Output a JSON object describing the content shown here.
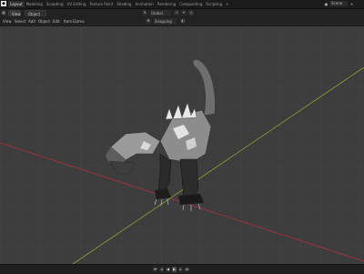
{
  "app": {
    "logo_label": ""
  },
  "workspace_tabs": [
    "Layout",
    "Modeling",
    "Sculpting",
    "UV Editing",
    "Texture Paint",
    "Shading",
    "Animation",
    "Rendering",
    "Compositing",
    "Scripting",
    "+"
  ],
  "active_tab_index": 0,
  "scene": {
    "field_label": "Scene",
    "view_layer_label": "View Layer"
  },
  "mode": {
    "object_mode_label": "Object Mode",
    "view_label": "View"
  },
  "header3": {
    "menu": [
      "View",
      "Select",
      "Add",
      "Object",
      "Edit",
      "Item",
      "Gizmo"
    ]
  },
  "transform": {
    "global_label": "Global",
    "snap_label": "Snapping"
  },
  "viewport": {
    "grid": true,
    "axis_colors": {
      "x": "#b0303f",
      "y": "#8fa233"
    },
    "model": "dinosaur"
  },
  "playback": {
    "buttons": [
      "skip-start-icon",
      "jump-back-icon",
      "play-back-icon",
      "play-icon",
      "jump-forward-icon",
      "skip-end-icon"
    ]
  }
}
